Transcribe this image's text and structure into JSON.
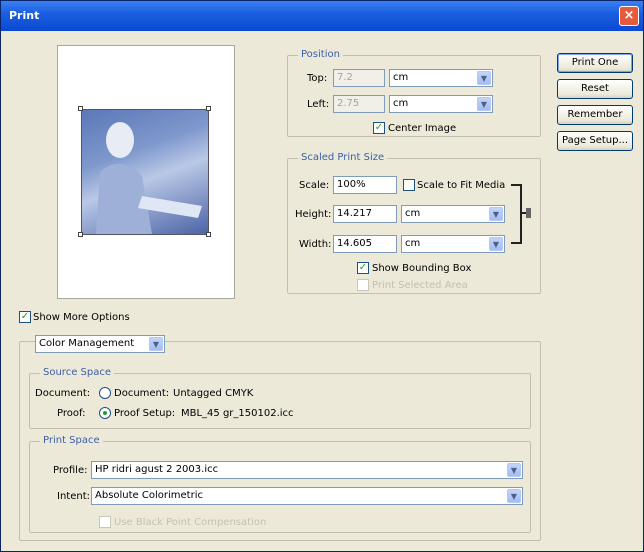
{
  "window": {
    "title": "Print",
    "close_label": "×"
  },
  "buttons": {
    "print_one": "Print One",
    "reset": "Reset",
    "remember": "Remember",
    "page_setup": "Page Setup..."
  },
  "position": {
    "title": "Position",
    "top_label": "Top:",
    "top_value": "7.2",
    "top_unit": "cm",
    "left_label": "Left:",
    "left_value": "2.75",
    "left_unit": "cm",
    "center_image_label": "Center Image",
    "center_image_checked": true
  },
  "scaled": {
    "title": "Scaled Print Size",
    "scale_label": "Scale:",
    "scale_value": "100%",
    "fit_media_label": "Scale to Fit Media",
    "fit_media_checked": false,
    "height_label": "Height:",
    "height_value": "14.217",
    "height_unit": "cm",
    "width_label": "Width:",
    "width_value": "14.605",
    "width_unit": "cm",
    "bounding_box_label": "Show Bounding Box",
    "bounding_box_checked": true,
    "print_selected_label": "Print Selected Area",
    "print_selected_checked": false
  },
  "more_options": {
    "label": "Show More Options",
    "checked": true,
    "section_select": "Color Management"
  },
  "source_space": {
    "title": "Source Space",
    "document_label": "Document:",
    "document_option": "Document:",
    "document_value": "Untagged CMYK",
    "proof_label": "Proof:",
    "proof_option": "Proof Setup:",
    "proof_value": "MBL_45 gr_150102.icc",
    "selected": "proof"
  },
  "print_space": {
    "title": "Print Space",
    "profile_label": "Profile:",
    "profile_value": "HP ridri agust 2 2003.icc",
    "intent_label": "Intent:",
    "intent_value": "Absolute Colorimetric",
    "bpc_label": "Use Black Point Compensation",
    "bpc_checked": false
  },
  "icons": {
    "dropdown": "chevron-down-icon",
    "checkmark": "check-icon",
    "link": "chain-link-icon"
  },
  "colors": {
    "titlebar": "#0a49d3",
    "dialog": "#ece9d8",
    "group_title": "#3c5fa8",
    "check": "#21a121"
  }
}
